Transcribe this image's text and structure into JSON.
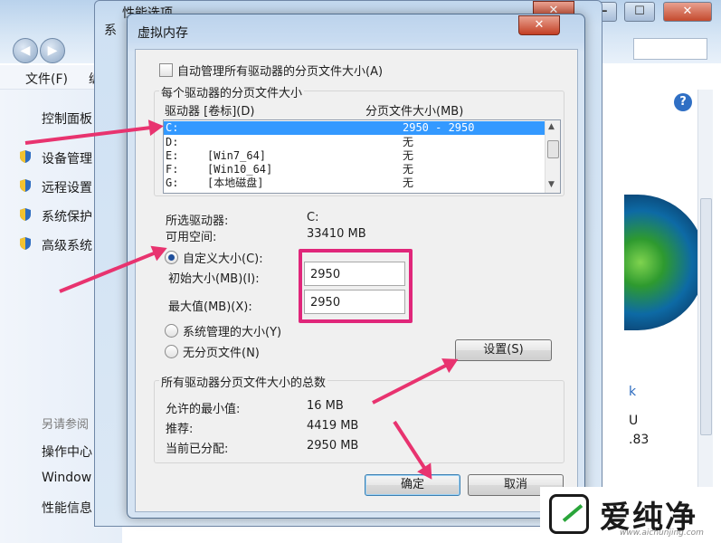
{
  "background_window": {
    "menu": [
      "文件(F)",
      "编"
    ],
    "left_links": [
      "控制面板",
      "设备管理",
      "远程设置",
      "系统保护",
      "高级系统"
    ],
    "see_also_label": "另请参阅",
    "bottom_links": [
      "操作中心",
      "Window",
      "性能信息"
    ],
    "right_texts": [
      "k",
      "U",
      ".83"
    ],
    "title_buttons": {
      "minimize": "—",
      "maximize": "☐",
      "close": "✕"
    }
  },
  "perf_window": {
    "title": "性能选项",
    "tab_fragment": "系"
  },
  "dialog": {
    "title": "虚拟内存",
    "auto_manage_label": "自动管理所有驱动器的分页文件大小(A)",
    "per_drive_group": "每个驱动器的分页文件大小",
    "col_drive": "驱动器 [卷标](D)",
    "col_size": "分页文件大小(MB)",
    "drives": [
      {
        "letter": "C:",
        "label": "",
        "size": "2950 - 2950",
        "selected": true
      },
      {
        "letter": "D:",
        "label": "",
        "size": "无",
        "selected": false
      },
      {
        "letter": "E:",
        "label": "[Win7_64]",
        "size": "无",
        "selected": false
      },
      {
        "letter": "F:",
        "label": "[Win10_64]",
        "size": "无",
        "selected": false
      },
      {
        "letter": "G:",
        "label": "[本地磁盘]",
        "size": "无",
        "selected": false
      }
    ],
    "selected_drive_label": "所选驱动器:",
    "selected_drive_value": "C:",
    "free_space_label": "可用空间:",
    "free_space_value": "33410 MB",
    "custom_size_label": "自定义大小(C):",
    "initial_size_label": "初始大小(MB)(I):",
    "initial_size_value": "2950",
    "max_size_label": "最大值(MB)(X):",
    "max_size_value": "2950",
    "system_managed_label": "系统管理的大小(Y)",
    "no_paging_label": "无分页文件(N)",
    "set_button": "设置(S)",
    "total_group": "所有驱动器分页文件大小的总数",
    "min_allowed_label": "允许的最小值:",
    "min_allowed_value": "16 MB",
    "recommended_label": "推荐:",
    "recommended_value": "4419 MB",
    "current_label": "当前已分配:",
    "current_value": "2950 MB",
    "ok_button": "确定",
    "cancel_button": "取消",
    "close_glyph": "✕",
    "selected_mode": "custom"
  },
  "watermark": {
    "brand": "爱纯净",
    "url": "www.aichunjing.com"
  },
  "colors": {
    "annotation": "#e8336f",
    "selection": "#3399ff"
  }
}
